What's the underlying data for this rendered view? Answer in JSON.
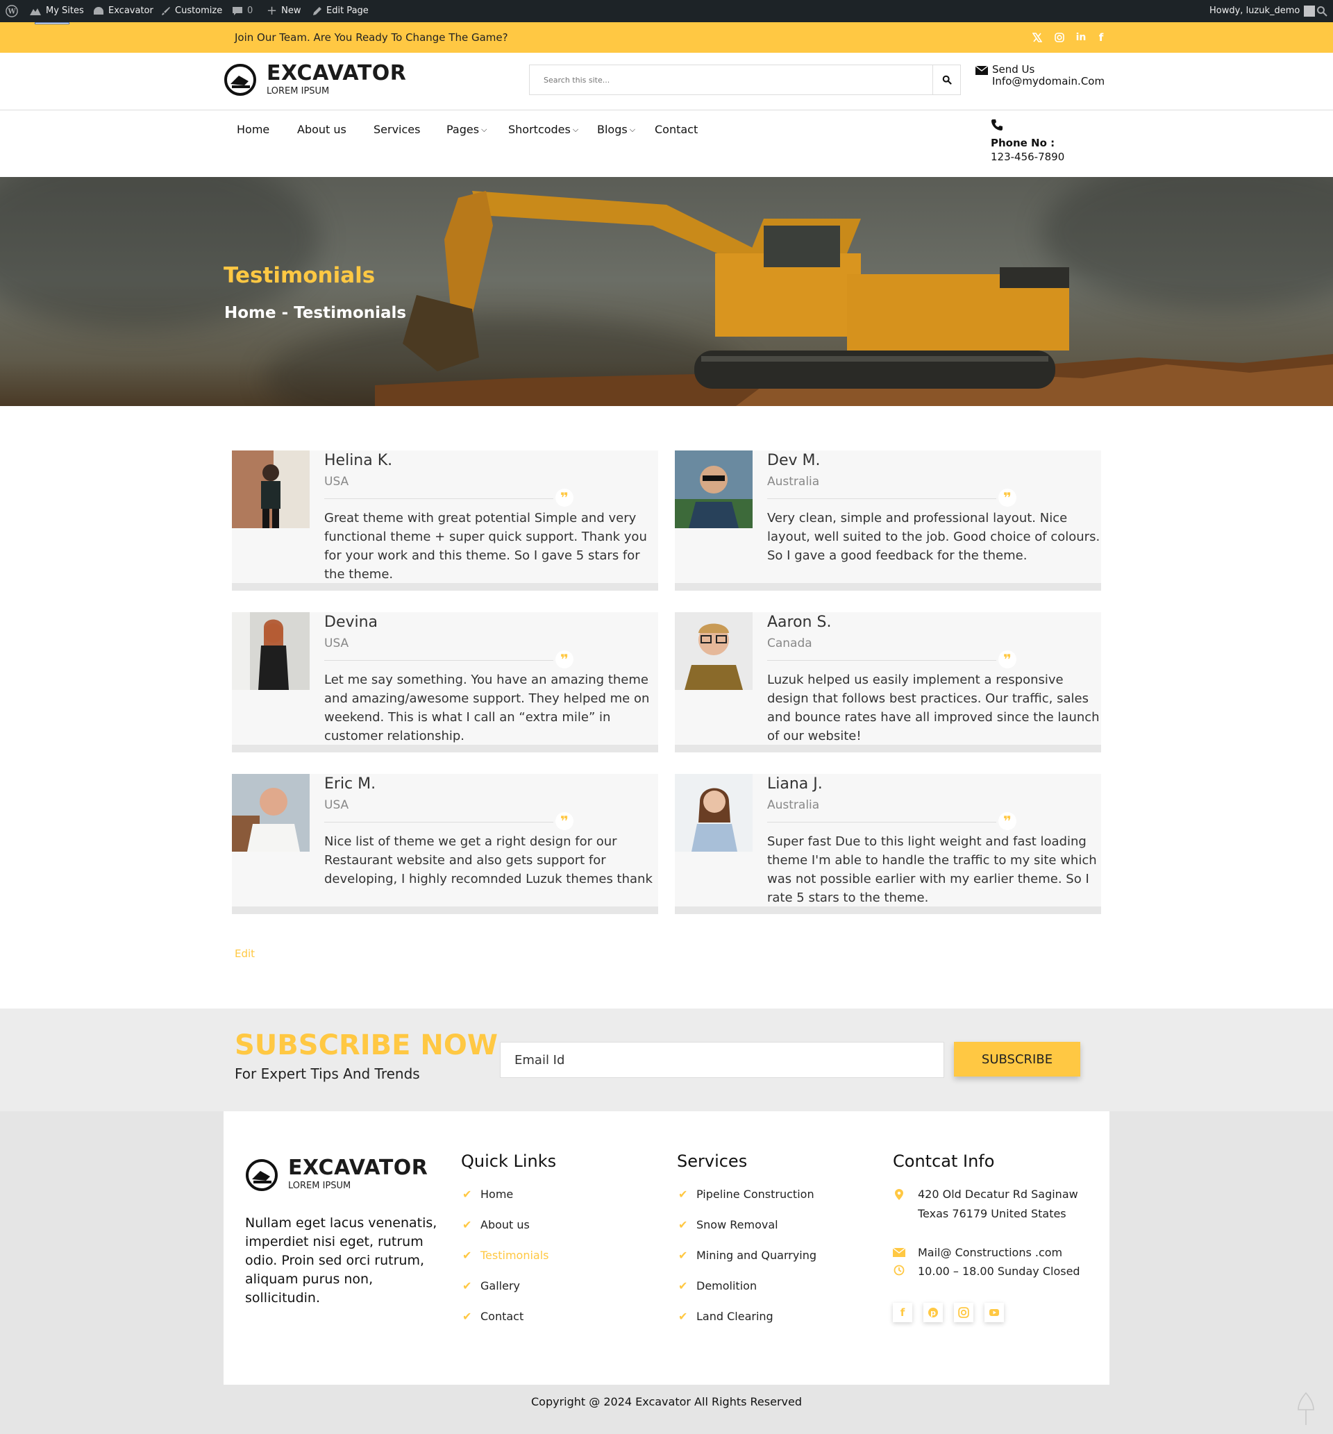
{
  "adminbar": {
    "my_sites": "My Sites",
    "site_name": "Excavator",
    "customize": "Customize",
    "comments_count": "0",
    "new_label": "New",
    "edit_page": "Edit Page",
    "howdy": "Howdy, luzuk_demo"
  },
  "topstrip": {
    "message": "Join Our Team. Are You Ready To Change The Game?",
    "social_icons": [
      "x-icon",
      "instagram-icon",
      "linkedin-icon",
      "facebook-icon"
    ]
  },
  "header": {
    "logo_title": "EXCAVATOR",
    "logo_subtitle": "LOREM IPSUM",
    "search_placeholder": "Search this site...",
    "send_us_label": "Send Us",
    "email": "Info@mydomain.Com"
  },
  "nav": {
    "items": [
      {
        "label": "Home",
        "dropdown": false
      },
      {
        "label": "About us",
        "dropdown": false
      },
      {
        "label": "Services",
        "dropdown": false
      },
      {
        "label": "Pages",
        "dropdown": true
      },
      {
        "label": "Shortcodes",
        "dropdown": true
      },
      {
        "label": "Blogs",
        "dropdown": true
      },
      {
        "label": "Contact",
        "dropdown": false
      }
    ],
    "phone_label": "Phone No :",
    "phone_number": "123-456-7890"
  },
  "hero": {
    "title": "Testimonials",
    "breadcrumb": "Home - Testimonials"
  },
  "testimonials": [
    {
      "name": "Helina K.",
      "location": "USA",
      "text": "Great theme with great potential Simple and very functional theme + super quick support. Thank you for your work and this theme. So I gave 5 stars for the theme."
    },
    {
      "name": "Dev M.",
      "location": "Australia",
      "text": "Very clean, simple and professional layout. Nice layout, well suited to the job. Good choice of colours. So I gave a good feedback for the theme."
    },
    {
      "name": "Devina",
      "location": "USA",
      "text": "Let me say something. You have an amazing theme and amazing/awesome support. They helped me on weekend. This is what I call an “extra mile” in customer relationship."
    },
    {
      "name": "Aaron S.",
      "location": "Canada",
      "text": "Luzuk helped us easily implement a responsive design that follows best practices. Our traffic, sales and bounce rates have all improved since the launch of our website!"
    },
    {
      "name": "Eric M.",
      "location": "USA",
      "text": "Nice list of theme we get a right design for our Restaurant website and also gets support for developing, I highly recomnded Luzuk themes thank"
    },
    {
      "name": "Liana J.",
      "location": "Australia",
      "text": "Super fast Due to this light weight and fast loading theme I'm able to handle the traffic to my site which was not possible earlier with my earlier theme. So I rate 5 stars to the theme."
    }
  ],
  "edit_link": "Edit",
  "subscribe": {
    "title": "SUBSCRIBE NOW",
    "subtitle": "For Expert Tips And Trends",
    "email_value": "Email Id",
    "button_label": "SUBSCRIBE"
  },
  "footer": {
    "logo_title": "EXCAVATOR",
    "logo_subtitle": "LOREM IPSUM",
    "about_text": "Nullam eget lacus venenatis, imperdiet nisi eget, rutrum odio. Proin sed orci rutrum, aliquam purus non, sollicitudin.",
    "quick_links_title": "Quick Links",
    "quick_links": [
      "Home",
      "About us",
      "Testimonials",
      "Gallery",
      "Contact"
    ],
    "quick_links_active": "Testimonials",
    "services_title": "Services",
    "services": [
      "Pipeline Construction",
      "Snow Removal",
      "Mining and Quarrying",
      "Demolition",
      "Land Clearing"
    ],
    "contact_title": "Contcat Info",
    "address": "420 Old Decatur Rd Saginaw Texas 76179 United States",
    "mail": "Mail@ Constructions .com",
    "hours": "10.00 – 18.00 Sunday Closed",
    "social_icons": [
      "facebook-icon",
      "pinterest-icon",
      "instagram-icon",
      "youtube-icon"
    ],
    "copyright": "Copyright @ 2024 Excavator All Rights Reserved"
  },
  "colors": {
    "accent": "#ffc843",
    "admin_bar": "#1d2327",
    "footer_bg": "#e5e5e5",
    "card_bg": "#f7f7f7"
  }
}
